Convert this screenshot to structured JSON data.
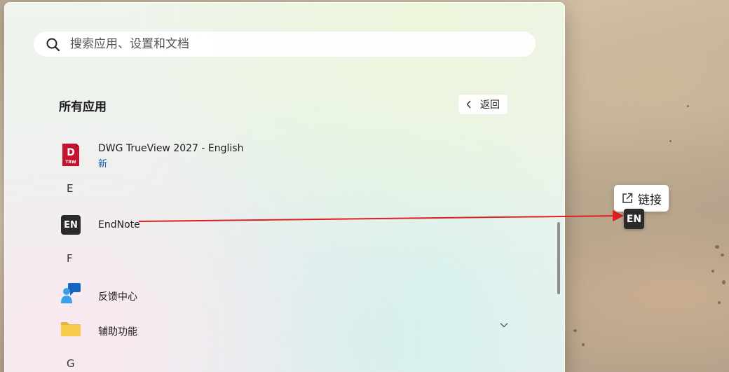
{
  "search": {
    "placeholder": "搜索应用、设置和文档"
  },
  "all_apps": {
    "title": "所有应用",
    "back_label": "返回"
  },
  "apps": [
    {
      "name": "DWG TrueView 2027 - English",
      "badge": "新",
      "icon": "dwg-trueview-icon",
      "icon_text": "D",
      "icon_subtext": "TRW"
    },
    {
      "letter": "E"
    },
    {
      "name": "EndNote",
      "icon": "endnote-icon",
      "icon_text": "EN"
    },
    {
      "letter": "F"
    },
    {
      "name": "反馈中心",
      "icon": "feedback-hub-icon"
    },
    {
      "name": "辅助功能",
      "icon": "folder-icon",
      "expandable": true
    },
    {
      "letter": "G"
    }
  ],
  "drag": {
    "tooltip_label": "链接",
    "ghost_icon_text": "EN"
  },
  "colors": {
    "accent_badge": "#0a5aa8",
    "drag_arrow": "#e02020",
    "dwg_icon": "#c4122f",
    "endnote_icon": "#2a2a2a"
  }
}
